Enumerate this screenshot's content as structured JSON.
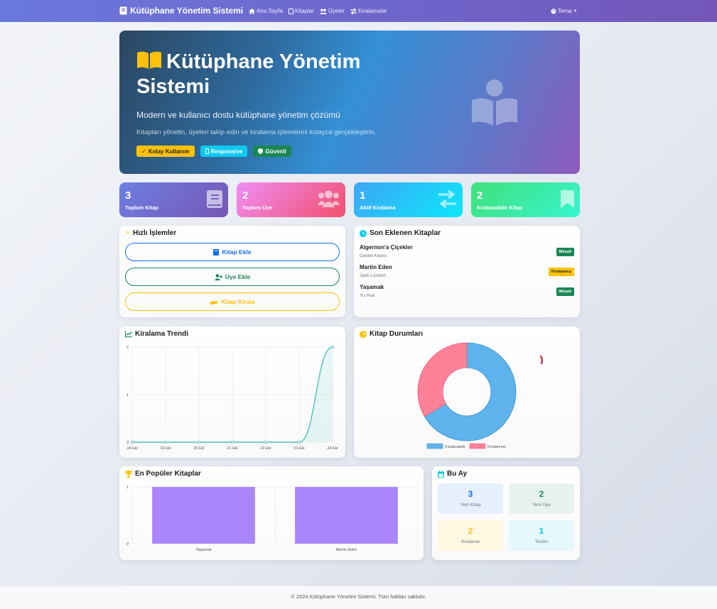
{
  "navbar": {
    "brand": "Kütüphane Yönetim Sistemi",
    "links": [
      {
        "label": "Ana Sayfa",
        "icon": "home-icon"
      },
      {
        "label": "Kitaplar",
        "icon": "book-icon"
      },
      {
        "label": "Üyeler",
        "icon": "users-icon"
      },
      {
        "label": "Kiralamalar",
        "icon": "exchange-icon"
      }
    ],
    "theme_label": "Tema"
  },
  "hero": {
    "title": "Kütüphane Yönetim Sistemi",
    "subtitle": "Modern ve kullanıcı dostu kütüphane yönetim çözümü",
    "description": "Kitapları yönetin, üyeleri takip edin ve kiralama işlemlerini kolayca gerçekleştirin.",
    "badges": [
      "Kolay Kullanım",
      "Responsive",
      "Güvenli"
    ]
  },
  "stats": [
    {
      "value": "3",
      "label": "Toplam Kitap",
      "icon": "book-icon"
    },
    {
      "value": "2",
      "label": "Toplam Üye",
      "icon": "users-icon"
    },
    {
      "value": "1",
      "label": "Aktif Kiralama",
      "icon": "exchange-icon"
    },
    {
      "value": "2",
      "label": "Kiralanabilir Kitap",
      "icon": "bookmark-icon"
    }
  ],
  "quick_actions": {
    "title": "Hızlı İşlemler",
    "buttons": [
      "Kitap Ekle",
      "Üye Ekle",
      "Kitap Kirala"
    ]
  },
  "recent_books": {
    "title": "Son Eklenen Kitaplar",
    "items": [
      {
        "title": "Algernon'a Çiçekler",
        "author": "Daniel Keyes",
        "status": "Müsait",
        "status_color": "#198754"
      },
      {
        "title": "Martin Eden",
        "author": "Jack London",
        "status": "Kiralanmış",
        "status_color": "#ffc107"
      },
      {
        "title": "Yaşamak",
        "author": "Yu Hua",
        "status": "Müsait",
        "status_color": "#198754"
      }
    ]
  },
  "rental_trend": {
    "title": "Kiralama Trendi"
  },
  "book_status": {
    "title": "Kitap Durumları"
  },
  "popular_books": {
    "title": "En Popüler Kitaplar"
  },
  "this_month": {
    "title": "Bu Ay",
    "items": [
      {
        "value": "3",
        "label": "Yeni Kitap",
        "color": "#0d6efd"
      },
      {
        "value": "2",
        "label": "Yeni Üye",
        "color": "#198754"
      },
      {
        "value": "2",
        "label": "Kiralama",
        "color": "#ffc107"
      },
      {
        "value": "1",
        "label": "Teslim",
        "color": "#0dcaf0"
      }
    ]
  },
  "footer": "© 2024 Kütüphane Yönetim Sistemi. Tüm hakları saklıdır.",
  "chart_data": [
    {
      "type": "area",
      "title": "Kiralama Trendi",
      "categories": [
        "18 Eki",
        "19 Eki",
        "20 Eki",
        "21 Eki",
        "22 Eki",
        "23 Eki",
        "24 Eki"
      ],
      "values": [
        0,
        0,
        0,
        0,
        0,
        0,
        2
      ],
      "ylim": [
        0,
        2
      ],
      "yticks": [
        "0",
        "1",
        "2"
      ],
      "color": "#4bc0c0",
      "grid": true
    },
    {
      "type": "pie",
      "title": "Kitap Durumları",
      "labels": [
        "Kiralanabilir",
        "Kiralanmış"
      ],
      "values": [
        2,
        1
      ],
      "colors": [
        "#5fb3ed",
        "#ff8198"
      ],
      "legend": "bottom"
    },
    {
      "type": "bar",
      "title": "En Popüler Kitaplar",
      "categories": [
        "Yaşamak",
        "Martin Eden"
      ],
      "values": [
        1,
        1
      ],
      "ylim": [
        0,
        1
      ],
      "yticks": [
        "0",
        "1"
      ],
      "color": "#ab85fb",
      "grid": true
    }
  ]
}
